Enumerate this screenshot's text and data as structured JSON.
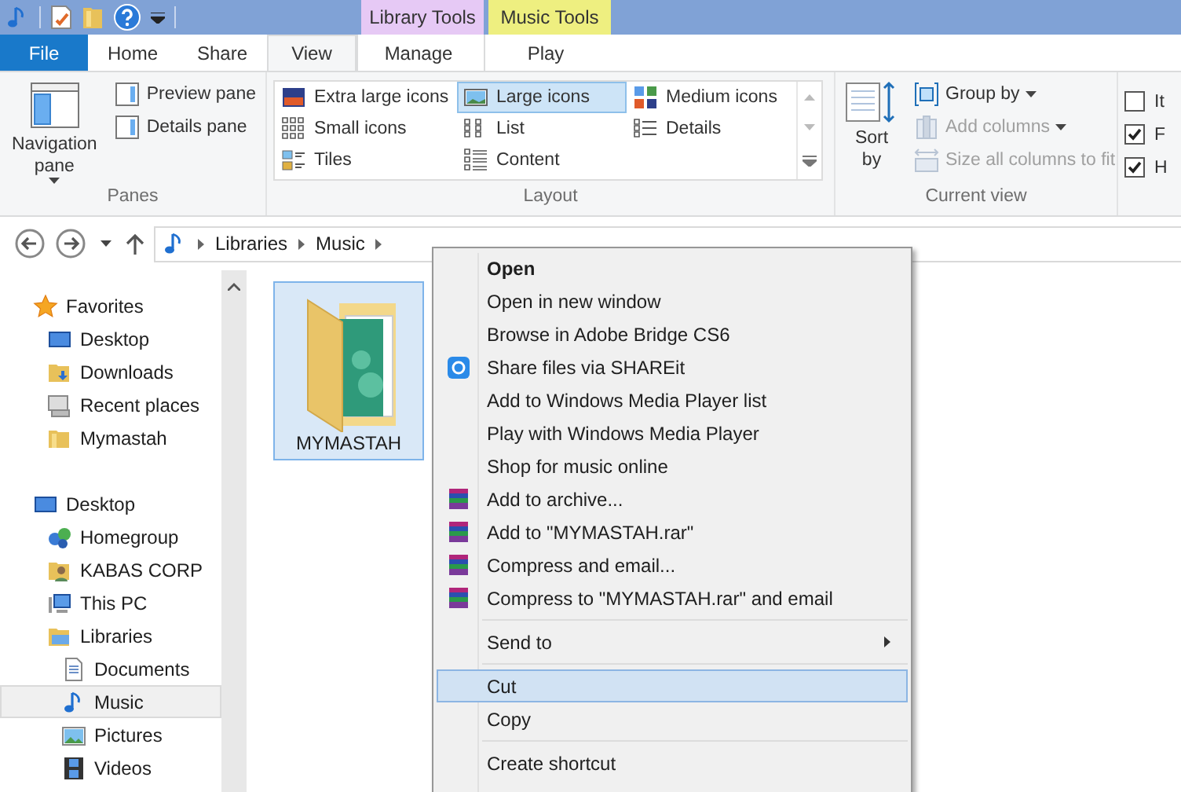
{
  "contextual_tabs": [
    {
      "label": "Library Tools",
      "color": "#e6c9f5"
    },
    {
      "label": "Music Tools",
      "color": "#eeef80"
    }
  ],
  "tabs": [
    {
      "label": "File",
      "kind": "file",
      "selected": false
    },
    {
      "label": "Home",
      "kind": "normal",
      "selected": false
    },
    {
      "label": "Share",
      "kind": "normal",
      "selected": false
    },
    {
      "label": "View",
      "kind": "normal",
      "selected": true
    },
    {
      "label": "Manage",
      "kind": "contextual",
      "selected": false
    },
    {
      "label": "Play",
      "kind": "contextual",
      "selected": false
    }
  ],
  "panes": {
    "label": "Panes",
    "big_button": "Navigation pane",
    "buttons": [
      "Preview pane",
      "Details pane"
    ]
  },
  "layout": {
    "label": "Layout",
    "options": [
      {
        "label": "Extra large icons",
        "selected": false
      },
      {
        "label": "Large icons",
        "selected": true
      },
      {
        "label": "Medium icons",
        "selected": false
      },
      {
        "label": "Small icons",
        "selected": false
      },
      {
        "label": "List",
        "selected": false
      },
      {
        "label": "Details",
        "selected": false
      },
      {
        "label": "Tiles",
        "selected": false
      },
      {
        "label": "Content",
        "selected": false
      }
    ]
  },
  "current_view": {
    "label": "Current view",
    "sort_by": "Sort by",
    "buttons": [
      {
        "label": "Group by",
        "disabled": false,
        "dropdown": true
      },
      {
        "label": "Add columns",
        "disabled": true,
        "dropdown": true
      },
      {
        "label": "Size all columns to fit",
        "disabled": true,
        "dropdown": false
      }
    ]
  },
  "show": {
    "checkboxes": [
      {
        "label": "It",
        "checked": false
      },
      {
        "label": "F",
        "checked": true
      },
      {
        "label": "H",
        "checked": true
      }
    ]
  },
  "address_bar": {
    "path": [
      "Libraries",
      "Music"
    ]
  },
  "navigation_pane": {
    "sections": [
      {
        "label": "Favorites",
        "selected": false,
        "children": [
          {
            "label": "Desktop",
            "selected": false
          },
          {
            "label": "Downloads",
            "selected": false
          },
          {
            "label": "Recent places",
            "selected": false
          },
          {
            "label": "Mymastah",
            "selected": false
          }
        ]
      },
      {
        "label": "Desktop",
        "selected": false,
        "children": [
          {
            "label": "Homegroup",
            "selected": false
          },
          {
            "label": "KABAS CORP",
            "selected": false
          },
          {
            "label": "This PC",
            "selected": false
          },
          {
            "label": "Libraries",
            "selected": false,
            "children": [
              {
                "label": "Documents",
                "selected": false
              },
              {
                "label": "Music",
                "selected": true
              },
              {
                "label": "Pictures",
                "selected": false
              },
              {
                "label": "Videos",
                "selected": false
              }
            ]
          }
        ]
      }
    ]
  },
  "files": [
    {
      "name": "MYMASTAH",
      "selected": true
    }
  ],
  "context_menu": {
    "groups": [
      [
        {
          "label": "Open",
          "default": true,
          "selected": false
        },
        {
          "label": "Open in new window",
          "default": false,
          "selected": false
        },
        {
          "label": "Browse in Adobe Bridge CS6",
          "default": false,
          "selected": false
        },
        {
          "label": "Share files via SHAREit",
          "default": false,
          "selected": false
        },
        {
          "label": "Add to Windows Media Player list",
          "default": false,
          "selected": false
        },
        {
          "label": "Play with Windows Media Player",
          "default": false,
          "selected": false
        },
        {
          "label": "Shop for music online",
          "default": false,
          "selected": false
        },
        {
          "label": "Add to archive...",
          "default": false,
          "selected": false
        },
        {
          "label": "Add to \"MYMASTAH.rar\"",
          "default": false,
          "selected": false
        },
        {
          "label": "Compress and email...",
          "default": false,
          "selected": false
        },
        {
          "label": "Compress to \"MYMASTAH.rar\" and email",
          "default": false,
          "selected": false
        }
      ],
      [
        {
          "label": "Send to",
          "submenu": true,
          "default": false,
          "selected": false
        }
      ],
      [
        {
          "label": "Cut",
          "default": false,
          "selected": true
        },
        {
          "label": "Copy",
          "default": false,
          "selected": false
        }
      ],
      [
        {
          "label": "Create shortcut",
          "default": false,
          "selected": false
        }
      ]
    ]
  }
}
